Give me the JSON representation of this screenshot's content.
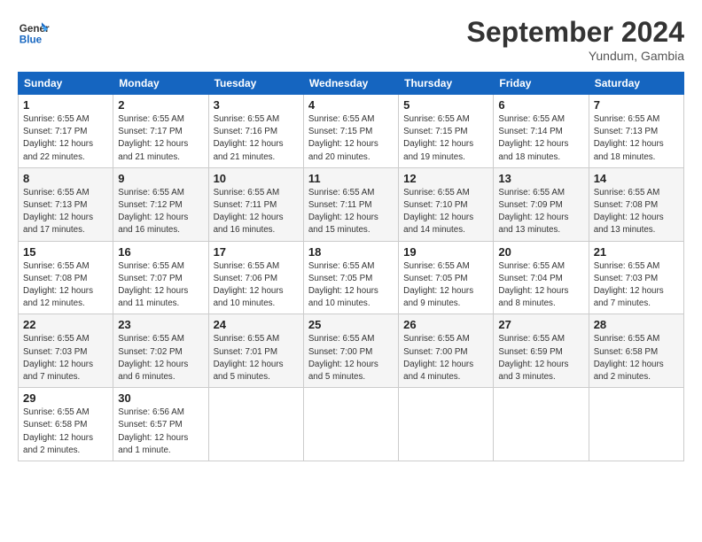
{
  "header": {
    "logo_line1": "General",
    "logo_line2": "Blue",
    "month": "September 2024",
    "location": "Yundum, Gambia"
  },
  "weekdays": [
    "Sunday",
    "Monday",
    "Tuesday",
    "Wednesday",
    "Thursday",
    "Friday",
    "Saturday"
  ],
  "weeks": [
    [
      {
        "day": "1",
        "info": "Sunrise: 6:55 AM\nSunset: 7:17 PM\nDaylight: 12 hours\nand 22 minutes."
      },
      {
        "day": "2",
        "info": "Sunrise: 6:55 AM\nSunset: 7:17 PM\nDaylight: 12 hours\nand 21 minutes."
      },
      {
        "day": "3",
        "info": "Sunrise: 6:55 AM\nSunset: 7:16 PM\nDaylight: 12 hours\nand 21 minutes."
      },
      {
        "day": "4",
        "info": "Sunrise: 6:55 AM\nSunset: 7:15 PM\nDaylight: 12 hours\nand 20 minutes."
      },
      {
        "day": "5",
        "info": "Sunrise: 6:55 AM\nSunset: 7:15 PM\nDaylight: 12 hours\nand 19 minutes."
      },
      {
        "day": "6",
        "info": "Sunrise: 6:55 AM\nSunset: 7:14 PM\nDaylight: 12 hours\nand 18 minutes."
      },
      {
        "day": "7",
        "info": "Sunrise: 6:55 AM\nSunset: 7:13 PM\nDaylight: 12 hours\nand 18 minutes."
      }
    ],
    [
      {
        "day": "8",
        "info": "Sunrise: 6:55 AM\nSunset: 7:13 PM\nDaylight: 12 hours\nand 17 minutes."
      },
      {
        "day": "9",
        "info": "Sunrise: 6:55 AM\nSunset: 7:12 PM\nDaylight: 12 hours\nand 16 minutes."
      },
      {
        "day": "10",
        "info": "Sunrise: 6:55 AM\nSunset: 7:11 PM\nDaylight: 12 hours\nand 16 minutes."
      },
      {
        "day": "11",
        "info": "Sunrise: 6:55 AM\nSunset: 7:11 PM\nDaylight: 12 hours\nand 15 minutes."
      },
      {
        "day": "12",
        "info": "Sunrise: 6:55 AM\nSunset: 7:10 PM\nDaylight: 12 hours\nand 14 minutes."
      },
      {
        "day": "13",
        "info": "Sunrise: 6:55 AM\nSunset: 7:09 PM\nDaylight: 12 hours\nand 13 minutes."
      },
      {
        "day": "14",
        "info": "Sunrise: 6:55 AM\nSunset: 7:08 PM\nDaylight: 12 hours\nand 13 minutes."
      }
    ],
    [
      {
        "day": "15",
        "info": "Sunrise: 6:55 AM\nSunset: 7:08 PM\nDaylight: 12 hours\nand 12 minutes."
      },
      {
        "day": "16",
        "info": "Sunrise: 6:55 AM\nSunset: 7:07 PM\nDaylight: 12 hours\nand 11 minutes."
      },
      {
        "day": "17",
        "info": "Sunrise: 6:55 AM\nSunset: 7:06 PM\nDaylight: 12 hours\nand 10 minutes."
      },
      {
        "day": "18",
        "info": "Sunrise: 6:55 AM\nSunset: 7:05 PM\nDaylight: 12 hours\nand 10 minutes."
      },
      {
        "day": "19",
        "info": "Sunrise: 6:55 AM\nSunset: 7:05 PM\nDaylight: 12 hours\nand 9 minutes."
      },
      {
        "day": "20",
        "info": "Sunrise: 6:55 AM\nSunset: 7:04 PM\nDaylight: 12 hours\nand 8 minutes."
      },
      {
        "day": "21",
        "info": "Sunrise: 6:55 AM\nSunset: 7:03 PM\nDaylight: 12 hours\nand 7 minutes."
      }
    ],
    [
      {
        "day": "22",
        "info": "Sunrise: 6:55 AM\nSunset: 7:03 PM\nDaylight: 12 hours\nand 7 minutes."
      },
      {
        "day": "23",
        "info": "Sunrise: 6:55 AM\nSunset: 7:02 PM\nDaylight: 12 hours\nand 6 minutes."
      },
      {
        "day": "24",
        "info": "Sunrise: 6:55 AM\nSunset: 7:01 PM\nDaylight: 12 hours\nand 5 minutes."
      },
      {
        "day": "25",
        "info": "Sunrise: 6:55 AM\nSunset: 7:00 PM\nDaylight: 12 hours\nand 5 minutes."
      },
      {
        "day": "26",
        "info": "Sunrise: 6:55 AM\nSunset: 7:00 PM\nDaylight: 12 hours\nand 4 minutes."
      },
      {
        "day": "27",
        "info": "Sunrise: 6:55 AM\nSunset: 6:59 PM\nDaylight: 12 hours\nand 3 minutes."
      },
      {
        "day": "28",
        "info": "Sunrise: 6:55 AM\nSunset: 6:58 PM\nDaylight: 12 hours\nand 2 minutes."
      }
    ],
    [
      {
        "day": "29",
        "info": "Sunrise: 6:55 AM\nSunset: 6:58 PM\nDaylight: 12 hours\nand 2 minutes."
      },
      {
        "day": "30",
        "info": "Sunrise: 6:56 AM\nSunset: 6:57 PM\nDaylight: 12 hours\nand 1 minute."
      },
      {
        "day": "",
        "info": ""
      },
      {
        "day": "",
        "info": ""
      },
      {
        "day": "",
        "info": ""
      },
      {
        "day": "",
        "info": ""
      },
      {
        "day": "",
        "info": ""
      }
    ]
  ]
}
